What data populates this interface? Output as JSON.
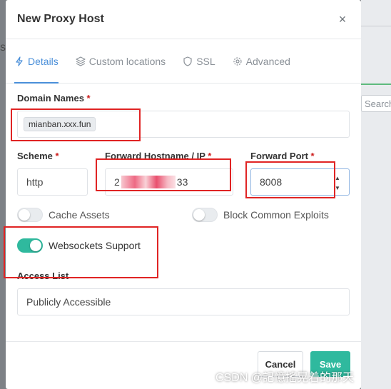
{
  "modal": {
    "title": "New Proxy Host",
    "close_glyph": "×"
  },
  "tabs": [
    {
      "label": "Details",
      "icon": "bolt-icon",
      "active": true
    },
    {
      "label": "Custom locations",
      "icon": "layers-icon",
      "active": false
    },
    {
      "label": "SSL",
      "icon": "shield-icon",
      "active": false
    },
    {
      "label": "Advanced",
      "icon": "gear-icon",
      "active": false
    }
  ],
  "form": {
    "domain_names": {
      "label": "Domain Names",
      "required_mark": "*",
      "tags": [
        "mianban.xxx.fun"
      ]
    },
    "scheme": {
      "label": "Scheme",
      "required_mark": "*",
      "value": "http"
    },
    "forward_hostname": {
      "label": "Forward Hostname / IP",
      "required_mark": "*",
      "value_prefix": "2",
      "value_suffix": "33"
    },
    "forward_port": {
      "label": "Forward Port",
      "required_mark": "*",
      "value": "8008"
    },
    "cache_assets": {
      "label": "Cache Assets",
      "on": false
    },
    "block_exploits": {
      "label": "Block Common Exploits",
      "on": false
    },
    "websockets": {
      "label": "Websockets Support",
      "on": true
    },
    "access_list": {
      "label": "Access List",
      "value": "Publicly Accessible"
    }
  },
  "footer": {
    "cancel_label": "Cancel",
    "save_label": "Save"
  },
  "background": {
    "search_placeholder": "Search",
    "left_fragment": "SS"
  },
  "watermark": "CSDN @記憶搖晃着的那天",
  "colors": {
    "accent": "#4a8fd9",
    "toggle_on": "#2fb99e",
    "required": "#cd201f",
    "annotation_red": "#e02424"
  }
}
